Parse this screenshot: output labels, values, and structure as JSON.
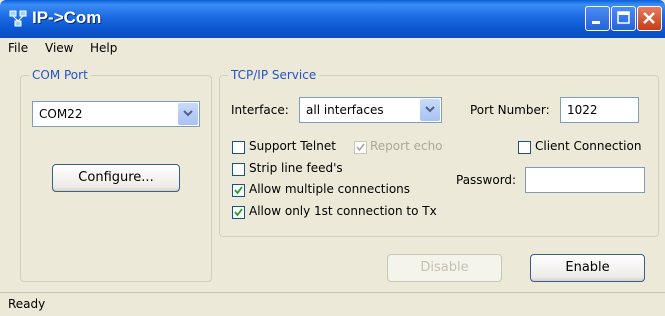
{
  "window": {
    "title": "IP->Com",
    "icon": "network-icon"
  },
  "menu": {
    "items": [
      "File",
      "View",
      "Help"
    ]
  },
  "com_port": {
    "group_label": "COM Port",
    "selected": "COM22",
    "configure_label": "Configure..."
  },
  "tcpip": {
    "group_label": "TCP/IP Service",
    "interface_label": "Interface:",
    "interface_value": "all interfaces",
    "port_label": "Port Number:",
    "port_value": "1022",
    "password_label": "Password:",
    "password_value": "",
    "checkboxes": [
      {
        "label": "Support Telnet",
        "checked": false,
        "enabled": true
      },
      {
        "label": "Report echo",
        "checked": true,
        "enabled": false
      },
      {
        "label": "Strip line feed's",
        "checked": false,
        "enabled": true
      },
      {
        "label": "Allow multiple connections",
        "checked": true,
        "enabled": true
      },
      {
        "label": "Allow only 1st connection to Tx",
        "checked": true,
        "enabled": true
      },
      {
        "label": "Client Connection",
        "checked": false,
        "enabled": true
      }
    ]
  },
  "buttons": {
    "disable_label": "Disable",
    "enable_label": "Enable"
  },
  "status": {
    "text": "Ready"
  }
}
